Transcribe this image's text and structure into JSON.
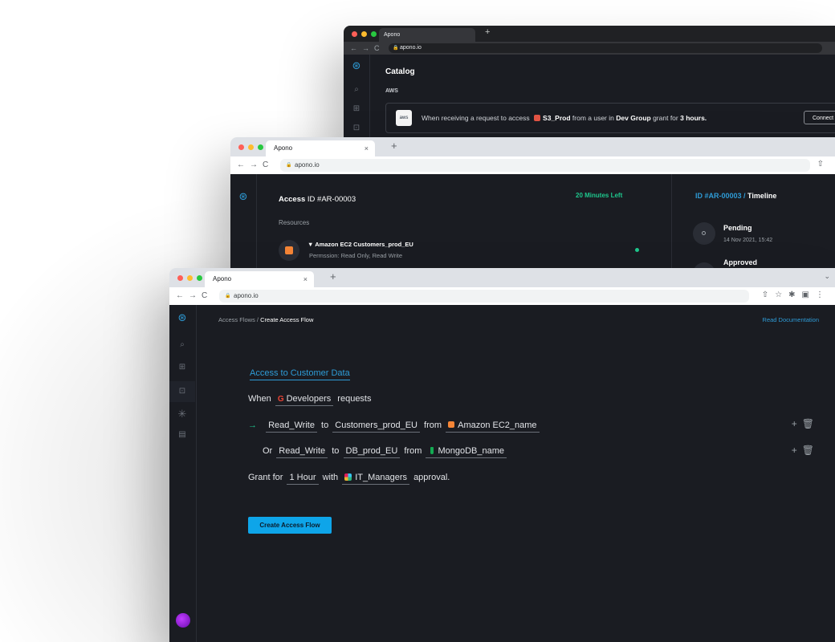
{
  "windows": {
    "back": {
      "tab_title": "Apono",
      "url": "apono.io",
      "page_title": "Catalog",
      "section_label": "AWS",
      "aws_logo_text": "aws",
      "card": {
        "text_1": "When receiving a request to access",
        "resource": "S3_Prod",
        "text_2": "from a user in",
        "group": "Dev Group",
        "text_3": "grant for",
        "duration": "3 hours.",
        "button": "Connect"
      }
    },
    "mid": {
      "tab_title": "Apono",
      "url": "apono.io",
      "access_label": "Access",
      "access_id": "ID #AR-00003",
      "time_left": "20 Minutes Left",
      "resources_label": "Resources",
      "resource_name": "▼ Amazon EC2 Customers_prod_EU",
      "resource_permission": "Permssion: Read Only, Read Write",
      "timeline_id": "ID #AR-00003 /",
      "timeline_label": "Timeline",
      "timeline": [
        {
          "status": "Pending",
          "date": "14 Nov 2021, 15:42"
        },
        {
          "status": "Approved",
          "date": ""
        }
      ]
    },
    "front": {
      "tab_title": "Apono",
      "url": "apono.io",
      "breadcrumb_parent": "Access Flows /",
      "breadcrumb_current": "Create Access Flow",
      "read_docs": "Read Documentation",
      "flow_title": "Access to Customer Data",
      "when": {
        "prefix": "When",
        "group": "Developers",
        "suffix": "requests"
      },
      "rule1": {
        "permission": "Read_Write",
        "to": "to",
        "resource": "Customers_prod_EU",
        "from": "from",
        "integration": "Amazon EC2_name"
      },
      "rule2": {
        "or": "Or",
        "permission": "Read_Write",
        "to": "to",
        "resource": "DB_prod_EU",
        "from": "from",
        "integration": "MongoDB_name"
      },
      "grant": {
        "prefix": "Grant for",
        "duration": "1 Hour",
        "with": "with",
        "approvers": "IT_Managers",
        "suffix": "approval."
      },
      "create_button": "Create Access Flow"
    }
  },
  "colors": {
    "app_bg": "#1a1c22",
    "accent_blue": "#2e9bd6",
    "accent_green": "#1ec78d",
    "button_blue": "#0ea5e9"
  }
}
